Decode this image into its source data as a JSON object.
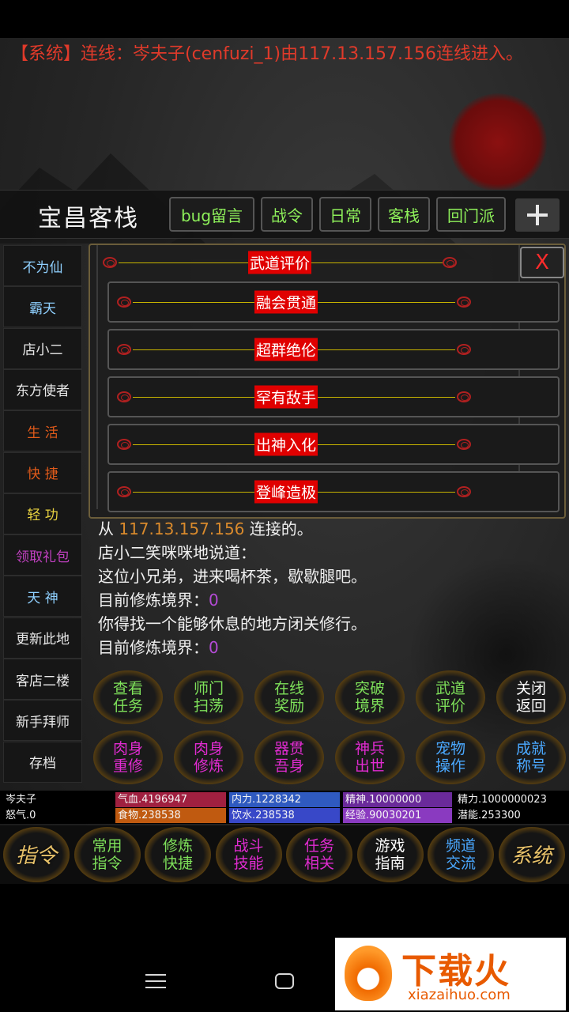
{
  "system_message": "【系统】连线：岑夫子(cenfuzi_1)由117.13.157.156连线进入。",
  "inn_title": "宝昌客栈",
  "tabs": [
    "bug留言",
    "战令",
    "日常",
    "客栈",
    "回门派"
  ],
  "tab_plus": "+",
  "sidebar": [
    {
      "label": "不为仙",
      "color": "#8fd0ff"
    },
    {
      "label": "霸天",
      "color": "#8fd0ff"
    },
    {
      "label": "店小二",
      "color": "#e8e8e8"
    },
    {
      "label": "东方使者",
      "color": "#e8e8e8"
    },
    {
      "label": "生  活",
      "color": "#e05a1a"
    },
    {
      "label": "快  捷",
      "color": "#e05a1a"
    },
    {
      "label": "轻  功",
      "color": "#e8d240"
    },
    {
      "label": "领取礼包",
      "color": "#c040c0"
    },
    {
      "label": "天  神",
      "color": "#8fd0ff"
    },
    {
      "label": "更新此地",
      "color": "#e8e8e8"
    },
    {
      "label": "客店二楼",
      "color": "#e8e8e8"
    },
    {
      "label": "新手拜师",
      "color": "#e8e8e8"
    },
    {
      "label": "存档",
      "color": "#e8e8e8"
    }
  ],
  "dialog": {
    "title": "武道评价",
    "close": "X",
    "options": [
      "融会贯通",
      "超群绝伦",
      "罕有敌手",
      "出神入化",
      "登峰造极"
    ]
  },
  "log": {
    "line1_prefix": "从 ",
    "line1_ip": "117.13.157.156",
    "line1_suffix": " 连接的。",
    "line2": "店小二笑咪咪地说道：",
    "line3": "这位小兄弟，进来喝杯茶，歇歇腿吧。",
    "line4_label": "目前修炼境界：",
    "line4_value": "0",
    "line5": "你得找一个能够休息的地方闭关修行。",
    "line6_label": "目前修炼境界：",
    "line6_value": "0"
  },
  "actions_row1": [
    {
      "l1": "查看",
      "l2": "任务",
      "color": "#7ee05a"
    },
    {
      "l1": "师门",
      "l2": "扫荡",
      "color": "#7ee05a"
    },
    {
      "l1": "在线",
      "l2": "奖励",
      "color": "#7ee05a"
    },
    {
      "l1": "突破",
      "l2": "境界",
      "color": "#7ee05a"
    },
    {
      "l1": "武道",
      "l2": "评价",
      "color": "#7ee05a"
    },
    {
      "l1": "关闭",
      "l2": "返回",
      "color": "#ffffff"
    }
  ],
  "actions_row2": [
    {
      "l1": "肉身",
      "l2": "重修",
      "color": "#e02bd0"
    },
    {
      "l1": "肉身",
      "l2": "修炼",
      "color": "#e02bd0"
    },
    {
      "l1": "器贯",
      "l2": "吾身",
      "color": "#e02bd0"
    },
    {
      "l1": "神兵",
      "l2": "出世",
      "color": "#e02bd0"
    },
    {
      "l1": "宠物",
      "l2": "操作",
      "color": "#4aa8ff"
    },
    {
      "l1": "成就",
      "l2": "称号",
      "color": "#4aa8ff"
    }
  ],
  "stats_row1": [
    {
      "text": "岑夫子",
      "bg": "#000000"
    },
    {
      "text": "气血.4196947",
      "bg": "#a02040"
    },
    {
      "text": "内力.1228342",
      "bg": "#2f5ac0"
    },
    {
      "text": "精神.10000000",
      "bg": "#6a2a9a"
    },
    {
      "text": "精力.1000000023",
      "bg": "#000000"
    }
  ],
  "stats_row2": [
    {
      "text": "怒气.0",
      "bg": "#000000"
    },
    {
      "text": "食物.238538",
      "bg": "#c05a10"
    },
    {
      "text": "饮水.238538",
      "bg": "#3848c8"
    },
    {
      "text": "经验.90030201",
      "bg": "#8a3ac0"
    },
    {
      "text": "潜能.253300",
      "bg": "#000000"
    }
  ],
  "menu": [
    {
      "big": "指令"
    },
    {
      "l1": "常用",
      "l2": "指令",
      "color": "#7ee05a"
    },
    {
      "l1": "修炼",
      "l2": "快捷",
      "color": "#7ee05a"
    },
    {
      "l1": "战斗",
      "l2": "技能",
      "color": "#e02bd0"
    },
    {
      "l1": "任务",
      "l2": "相关",
      "color": "#e02bd0"
    },
    {
      "l1": "游戏",
      "l2": "指南",
      "color": "#ffffff"
    },
    {
      "l1": "频道",
      "l2": "交流",
      "color": "#4aa8ff"
    },
    {
      "big": "系统"
    }
  ],
  "watermark": {
    "title": "下载火",
    "sub": "xiazaihuo.com"
  }
}
